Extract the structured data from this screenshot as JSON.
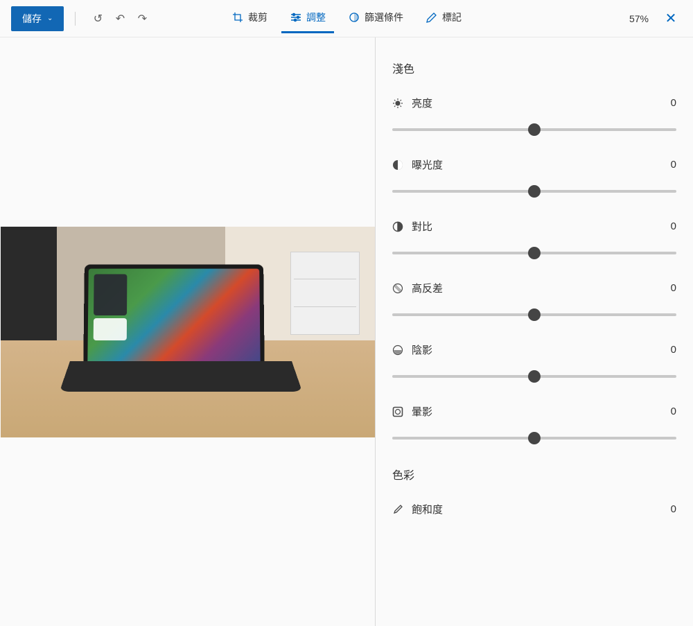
{
  "toolbar": {
    "save_label": "儲存",
    "zoom_label": "57%"
  },
  "tabs": {
    "crop": "裁剪",
    "adjust": "調整",
    "filter": "篩選條件",
    "markup": "標記"
  },
  "panel": {
    "light_section": "淺色",
    "color_section": "色彩",
    "brightness": {
      "label": "亮度",
      "value": "0"
    },
    "exposure": {
      "label": "曝光度",
      "value": "0"
    },
    "contrast": {
      "label": "對比",
      "value": "0"
    },
    "highlights": {
      "label": "高反差",
      "value": "0"
    },
    "shadows": {
      "label": "陰影",
      "value": "0"
    },
    "vignette": {
      "label": "暈影",
      "value": "0"
    },
    "saturation": {
      "label": "飽和度",
      "value": "0"
    }
  },
  "icons": {
    "history": "↺",
    "undo": "↶",
    "redo": "↷",
    "close": "✕",
    "chevron": "⌄"
  }
}
